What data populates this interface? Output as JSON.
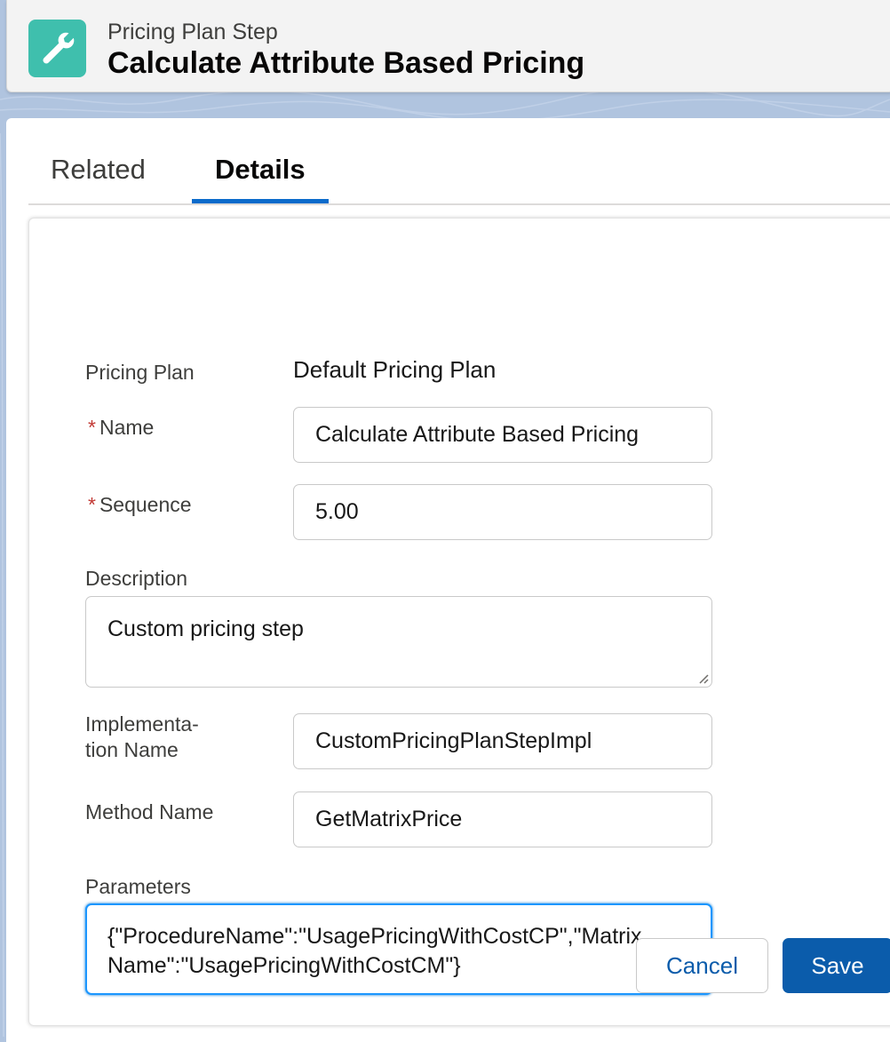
{
  "header": {
    "object_type": "Pricing Plan Step",
    "record_title": "Calculate Attribute Based Pricing",
    "icon": "wrench-icon",
    "icon_color": "#3fbfad"
  },
  "tabs": [
    {
      "label": "Related",
      "active": false
    },
    {
      "label": "Details",
      "active": true
    }
  ],
  "form": {
    "pricing_plan": {
      "label": "Pricing Plan",
      "value": "Default Pricing Plan"
    },
    "name": {
      "label": "Name",
      "value": "Calculate Attribute Based Pricing",
      "required": true
    },
    "sequence": {
      "label": "Sequence",
      "value": "5.00",
      "required": true
    },
    "description": {
      "label": "Description",
      "value": "Custom pricing step"
    },
    "implementation_name": {
      "label_line1": "Implementa-",
      "label_line2": "tion Name",
      "value": "CustomPricingPlanStepImpl"
    },
    "method_name": {
      "label": "Method Name",
      "value": "GetMatrixPrice"
    },
    "parameters": {
      "label": "Parameters",
      "value_line1": "{\"ProcedureName\":\"UsagePricingWithCostCP\",\"Matrix",
      "value_line2": "Name\":\"UsagePricingWithCostCM\"}"
    }
  },
  "required_marker": "*",
  "buttons": {
    "cancel": "Cancel",
    "save": "Save"
  },
  "colors": {
    "brand": "#0b5cab",
    "active_tab": "#0b6bcb",
    "required": "#c23934",
    "focus": "#1b96ff"
  }
}
